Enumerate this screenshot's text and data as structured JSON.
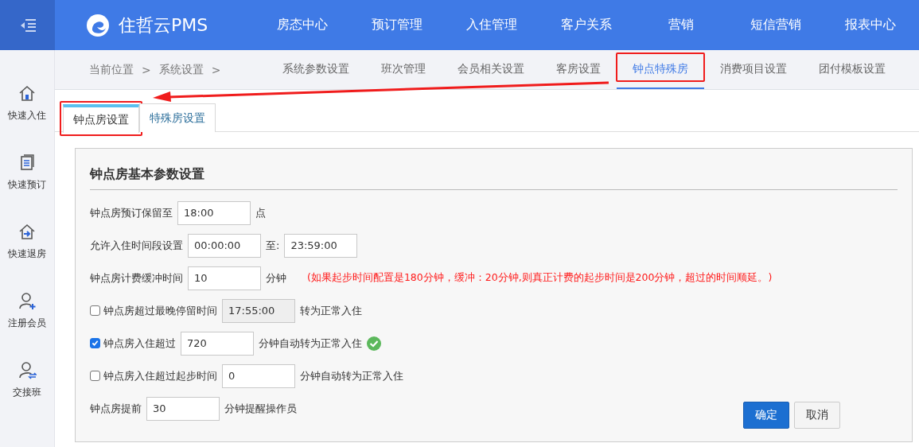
{
  "header": {
    "logo_text": "住哲云PMS",
    "nav": [
      "房态中心",
      "预订管理",
      "入住管理",
      "客户关系",
      "营销",
      "短信营销",
      "报表中心"
    ]
  },
  "sidebar": [
    {
      "label": "快速入住",
      "kind": "checkin"
    },
    {
      "label": "快速预订",
      "kind": "booking"
    },
    {
      "label": "快速退房",
      "kind": "checkout"
    },
    {
      "label": "注册会员",
      "kind": "member"
    },
    {
      "label": "交接班",
      "kind": "shift"
    }
  ],
  "breadcrumb": [
    "当前位置",
    ">",
    "系统设置",
    ">"
  ],
  "subnav": [
    {
      "label": "系统参数设置",
      "selected": false,
      "highlighted": false
    },
    {
      "label": "班次管理",
      "selected": false,
      "highlighted": false
    },
    {
      "label": "会员相关设置",
      "selected": false,
      "highlighted": false
    },
    {
      "label": "客房设置",
      "selected": false,
      "highlighted": false
    },
    {
      "label": "钟点特殊房",
      "selected": true,
      "highlighted": true
    },
    {
      "label": "消费项目设置",
      "selected": false,
      "highlighted": false
    },
    {
      "label": "团付模板设置",
      "selected": false,
      "highlighted": false
    }
  ],
  "tabs": [
    {
      "label": "钟点房设置",
      "selected": true,
      "highlighted": true
    },
    {
      "label": "特殊房设置",
      "selected": false,
      "highlighted": false
    }
  ],
  "panel": {
    "title": "钟点房基本参数设置",
    "rows": [
      {
        "valid": false,
        "items": [
          {
            "kind": "text",
            "text": "钟点房预订保留至"
          },
          {
            "kind": "input",
            "value": "18:00",
            "disabled": false
          },
          {
            "kind": "text",
            "text": "点"
          }
        ]
      },
      {
        "valid": false,
        "items": [
          {
            "kind": "text",
            "text": "允许入住时间段设置"
          },
          {
            "kind": "input",
            "value": "00:00:00",
            "disabled": false
          },
          {
            "kind": "text",
            "text": "至:"
          },
          {
            "kind": "input",
            "value": "23:59:00",
            "disabled": false
          }
        ]
      },
      {
        "valid": false,
        "items": [
          {
            "kind": "text",
            "text": "钟点房计费缓冲时间"
          },
          {
            "kind": "input",
            "value": "10",
            "disabled": false
          },
          {
            "kind": "text",
            "text": "分钟"
          },
          {
            "kind": "note",
            "text": "(如果起步时间配置是180分钟，缓冲：20分钟,则真正计费的起步时间是200分钟，超过的时间顺延。)"
          }
        ]
      },
      {
        "checked": false,
        "valid": false,
        "items": [
          {
            "kind": "text",
            "text": "钟点房超过最晚停留时间"
          },
          {
            "kind": "input",
            "value": "17:55:00",
            "disabled": true
          },
          {
            "kind": "text",
            "text": "转为正常入住"
          }
        ]
      },
      {
        "checked": true,
        "valid": true,
        "items": [
          {
            "kind": "text",
            "text": "钟点房入住超过"
          },
          {
            "kind": "input",
            "value": "720",
            "disabled": false
          },
          {
            "kind": "text",
            "text": "分钟自动转为正常入住"
          }
        ]
      },
      {
        "checked": false,
        "valid": false,
        "items": [
          {
            "kind": "text",
            "text": "钟点房入住超过起步时间"
          },
          {
            "kind": "input",
            "value": "0",
            "disabled": false
          },
          {
            "kind": "text",
            "text": "分钟自动转为正常入住"
          }
        ]
      },
      {
        "valid": false,
        "items": [
          {
            "kind": "text",
            "text": "钟点房提前"
          },
          {
            "kind": "input",
            "value": "30",
            "disabled": false
          },
          {
            "kind": "text",
            "text": "分钟提醒操作员"
          }
        ]
      }
    ]
  },
  "buttons": [
    {
      "label": "确定",
      "kind": "primary"
    },
    {
      "label": "取消",
      "kind": "default"
    }
  ]
}
